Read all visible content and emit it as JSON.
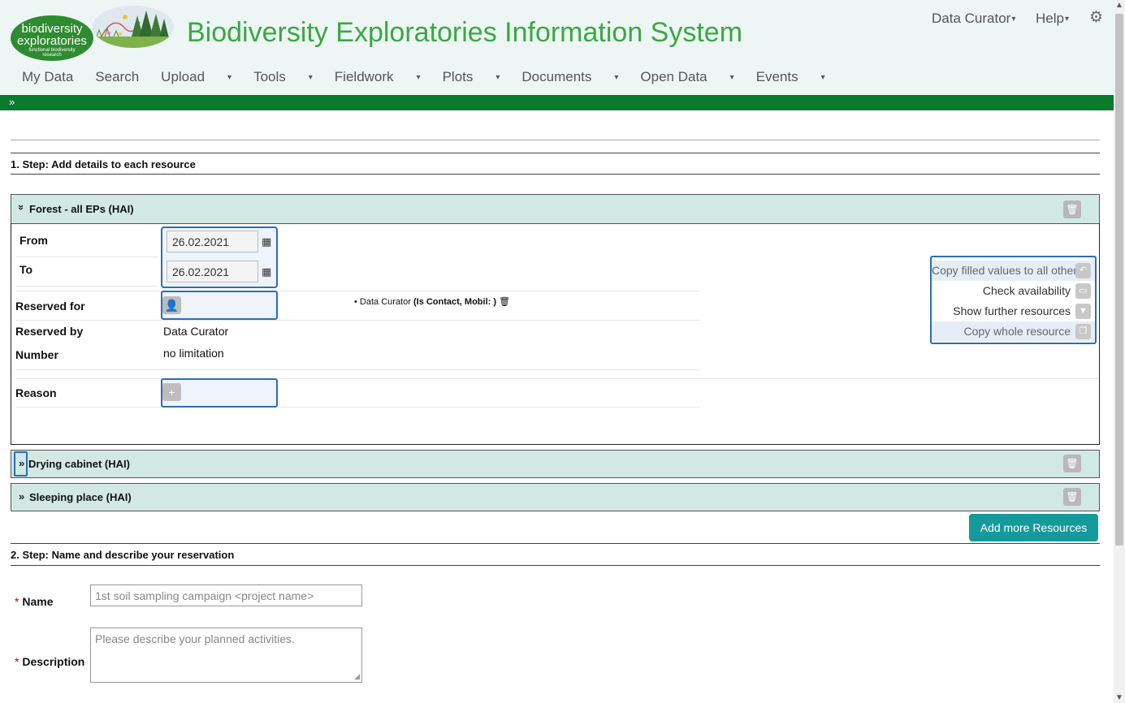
{
  "header": {
    "logo": {
      "line1": "biodiversity",
      "line2": "exploratories",
      "line3": "functional biodiversity",
      "line4": "research"
    },
    "title": "Biodiversity Exploratories Information System",
    "user_menu": "Data Curator",
    "help_menu": "Help",
    "settings_icon": "gear-icon"
  },
  "nav": {
    "items": [
      "My Data",
      "Search",
      "Upload",
      "Tools",
      "Fieldwork",
      "Plots",
      "Documents",
      "Open Data",
      "Events"
    ]
  },
  "step1": {
    "title": "1. Step: Add details to each resource",
    "panels": [
      {
        "title": "Forest - all EPs (HAI)",
        "expanded": true
      },
      {
        "title": "Drying cabinet (HAI)",
        "expanded": false
      },
      {
        "title": "Sleeping place (HAI)",
        "expanded": false
      }
    ],
    "form": {
      "from_label": "From",
      "from_value": "26.02.2021",
      "to_label": "To",
      "to_value": "26.02.2021",
      "reserved_for_label": "Reserved for",
      "reserved_by_label": "Reserved by",
      "reserved_by_value": "Data Curator",
      "number_label": "Number",
      "number_value": "no limitation",
      "reason_label": "Reason"
    },
    "contact": {
      "name": "Data Curator",
      "details": "(Is Contact, Mobil: )"
    },
    "actions": {
      "copy_filled": "Copy filled values to all other",
      "check_availability": "Check availability",
      "show_further": "Show further resources",
      "copy_whole": "Copy whole resource"
    },
    "add_more_label": "Add more Resources"
  },
  "step2": {
    "title": "2. Step: Name and describe your reservation",
    "required_mark": "*",
    "name_label": "Name",
    "name_placeholder": "1st soil sampling campaign <project name>",
    "description_label": "Description",
    "description_placeholder": "Please describe your planned activities."
  },
  "colors": {
    "title_green": "#3aa843",
    "bar_green": "#0a7a2f",
    "panel_bg": "#d2e9e3",
    "focus_blue": "#2f6db5",
    "add_button": "#159a9c"
  }
}
